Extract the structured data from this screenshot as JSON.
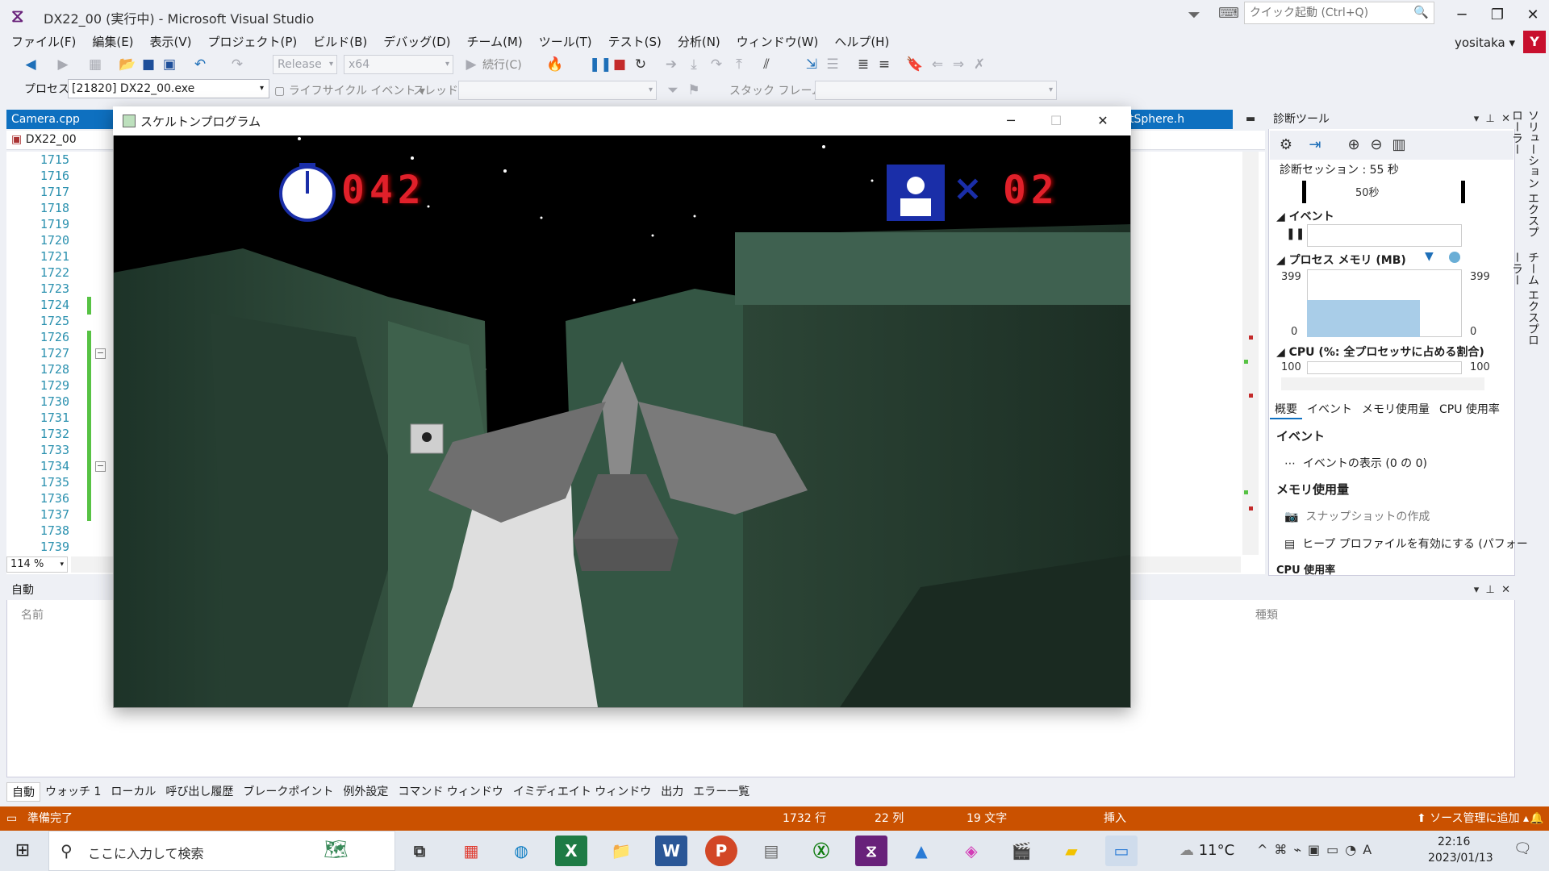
{
  "window": {
    "title": "DX22_00 (実行中) - Microsoft Visual Studio",
    "quick_launch_placeholder": "クイック起動 (Ctrl+Q)",
    "user": "yositaka",
    "user_initial": "Y",
    "logo": "vs-logo"
  },
  "menu": [
    "ファイル(F)",
    "編集(E)",
    "表示(V)",
    "プロジェクト(P)",
    "ビルド(B)",
    "デバッグ(D)",
    "チーム(M)",
    "ツール(T)",
    "テスト(S)",
    "分析(N)",
    "ウィンドウ(W)",
    "ヘルプ(H)"
  ],
  "toolbar": {
    "config": "Release",
    "platform": "x64",
    "continue_label": "続行(C)",
    "process_label": "プロセス:",
    "process_value": "[21820] DX22_00.exe",
    "lifecycle_label": "ライフサイクル イベント",
    "thread_label": "スレッド:",
    "stackframe_label": "スタック フレーム:"
  },
  "editor": {
    "tabs": [
      "Camera.cpp",
      "tSphere.h"
    ],
    "project": "DX22_00",
    "line_numbers": [
      "1715",
      "1716",
      "1717",
      "1718",
      "1719",
      "1720",
      "1721",
      "1722",
      "1723",
      "1724",
      "1725",
      "1726",
      "1727",
      "1728",
      "1729",
      "1730",
      "1731",
      "1732",
      "1733",
      "1734",
      "1735",
      "1736",
      "1737",
      "1738",
      "1739"
    ],
    "zoom": "114 %"
  },
  "game": {
    "title": "スケルトンプログラム",
    "timer": "042",
    "lives": "02",
    "lives_x": "×",
    "icons": [
      "stopwatch-icon",
      "player-icon"
    ],
    "colors": {
      "hud_red": "#e0202a",
      "hud_blue": "#1a2ea8",
      "wall_green": "#2e4a3a"
    }
  },
  "diag": {
    "title": "診断ツール",
    "session": "診断セッション : 55 秒",
    "timeline_mark": "50秒",
    "events_label": "イベント",
    "memory_label": "プロセス メモリ (MB)",
    "mem_max": "399",
    "mem_min": "0",
    "cpu_label": "CPU (%: 全プロセッサに占める割合)",
    "cpu_max": "100",
    "memory_fill_ratio": 0.55,
    "tabs": [
      "概要",
      "イベント",
      "メモリ使用量",
      "CPU 使用率"
    ],
    "sec_events": "イベント",
    "action_events": "イベントの表示 (0 の 0)",
    "sec_memory": "メモリ使用量",
    "action_snapshot": "スナップショットの作成",
    "action_heap": "ヒープ プロファイルを有効にする (パフォー",
    "sec_cpu": "CPU 使用率"
  },
  "side_tabs": [
    "ソリューション エクスプローラー",
    "チーム エクスプローラー"
  ],
  "auto_panel": {
    "title": "自動",
    "col_name": "名前",
    "col_type": "種類"
  },
  "bottom_tabs": [
    "自動",
    "ウォッチ 1",
    "ローカル",
    "呼び出し履歴",
    "ブレークポイント",
    "例外設定",
    "コマンド ウィンドウ",
    "イミディエイト ウィンドウ",
    "出力",
    "エラー一覧"
  ],
  "status": {
    "ready": "準備完了",
    "line": "1732 行",
    "col": "22 列",
    "chars": "19 文字",
    "mode": "挿入",
    "source_control": "ソース管理に追加"
  },
  "taskbar": {
    "search_placeholder": "ここに入力して検索",
    "temp": "11°C",
    "time": "22:16",
    "date": "2023/01/13",
    "ime": "A"
  }
}
